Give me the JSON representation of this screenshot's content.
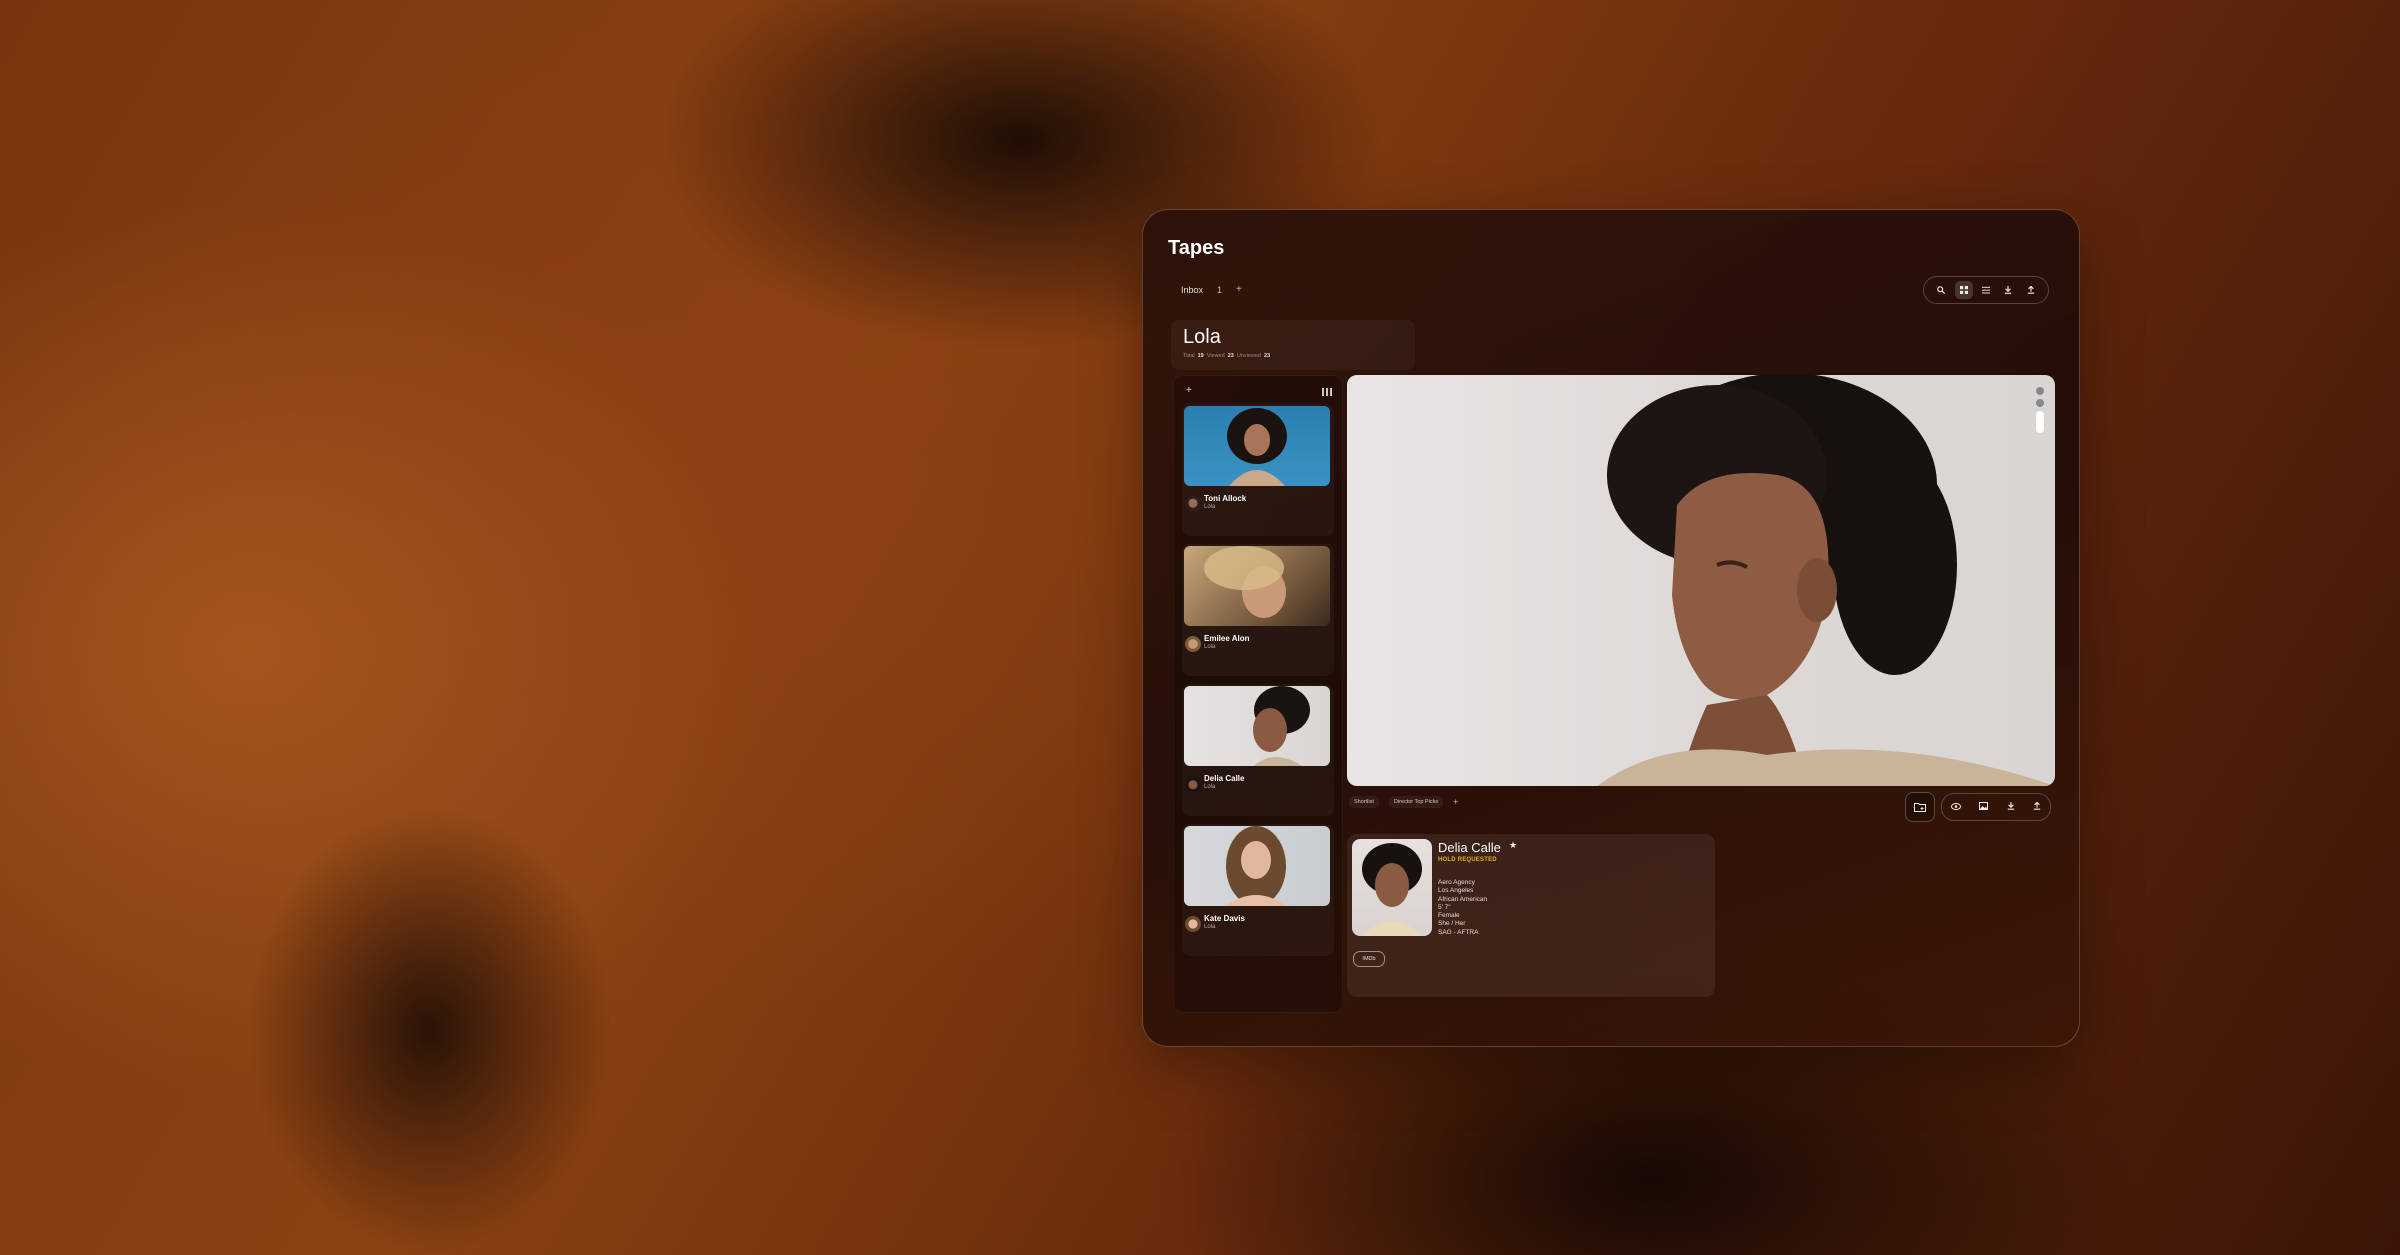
{
  "app": {
    "title": "Tapes"
  },
  "tabs": {
    "inbox_label": "Inbox",
    "inbox_count": "1",
    "add_label": "+"
  },
  "toolbar": {
    "icons": [
      "search-icon",
      "grid-view-icon",
      "list-view-icon",
      "download-icon",
      "upload-icon"
    ]
  },
  "project": {
    "name": "Lola",
    "stats": [
      {
        "label": "Total",
        "value": "19"
      },
      {
        "label": "Viewed",
        "value": "23"
      },
      {
        "label": "Unviewed",
        "value": "23"
      }
    ]
  },
  "list": {
    "add_label": "+",
    "items": [
      {
        "name": "Toni Allock",
        "role": "Lola"
      },
      {
        "name": "Emilee Alon",
        "role": "Lola"
      },
      {
        "name": "Delia Calle",
        "role": "Lola"
      },
      {
        "name": "Kate Davis",
        "role": "Lola"
      }
    ]
  },
  "viewer": {
    "chips": [
      "Shortlist",
      "Director Top Picks"
    ],
    "chip_add": "+"
  },
  "profile": {
    "name": "Delia Calle",
    "star": "★",
    "status": "HOLD REQUESTED",
    "details": [
      "Aero Agency",
      "Los Angeles",
      "African American",
      "5' 7\"",
      "Female",
      "She / Her",
      "SAG - AFTRA"
    ],
    "imdb_label": "IMDb"
  },
  "colors": {
    "status": "#e0b020",
    "accent_bg": "#2a110a"
  }
}
